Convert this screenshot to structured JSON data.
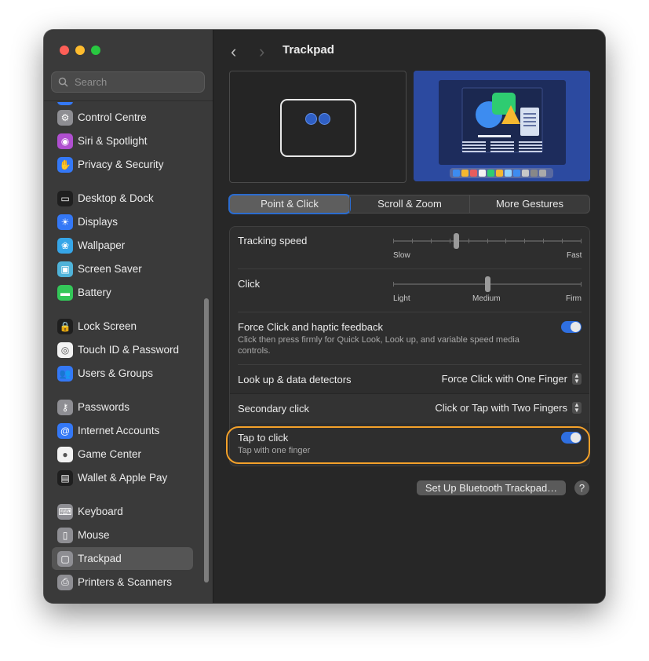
{
  "window": {
    "title": "Trackpad"
  },
  "search": {
    "placeholder": "Search"
  },
  "sidebar": {
    "items": [
      {
        "label": "Control Centre",
        "icon": "control-centre-icon",
        "color": "#8e8e93",
        "glyph": "⚙"
      },
      {
        "label": "Siri & Spotlight",
        "icon": "siri-icon",
        "color": "#b04fd0",
        "glyph": "◉"
      },
      {
        "label": "Privacy & Security",
        "icon": "hand-icon",
        "color": "#3478f6",
        "glyph": "✋"
      },
      {
        "label": "Desktop & Dock",
        "icon": "dock-icon",
        "color": "#1f1f1f",
        "glyph": "▭"
      },
      {
        "label": "Displays",
        "icon": "displays-icon",
        "color": "#3478f6",
        "glyph": "☀"
      },
      {
        "label": "Wallpaper",
        "icon": "wallpaper-icon",
        "color": "#36a6e8",
        "glyph": "❀"
      },
      {
        "label": "Screen Saver",
        "icon": "screen-saver-icon",
        "color": "#4fb3d9",
        "glyph": "▣"
      },
      {
        "label": "Battery",
        "icon": "battery-icon",
        "color": "#34c759",
        "glyph": "▬"
      },
      {
        "label": "Lock Screen",
        "icon": "lock-icon",
        "color": "#1f1f1f",
        "glyph": "🔒"
      },
      {
        "label": "Touch ID & Password",
        "icon": "fingerprint-icon",
        "color": "#f2f2f2",
        "glyph": "◎"
      },
      {
        "label": "Users & Groups",
        "icon": "users-icon",
        "color": "#3478f6",
        "glyph": "👥"
      },
      {
        "label": "Passwords",
        "icon": "key-icon",
        "color": "#8e8e93",
        "glyph": "⚷"
      },
      {
        "label": "Internet Accounts",
        "icon": "at-icon",
        "color": "#3478f6",
        "glyph": "@"
      },
      {
        "label": "Game Center",
        "icon": "game-center-icon",
        "color": "#f2f2f2",
        "glyph": "●"
      },
      {
        "label": "Wallet & Apple Pay",
        "icon": "wallet-icon",
        "color": "#1f1f1f",
        "glyph": "▤"
      },
      {
        "label": "Keyboard",
        "icon": "keyboard-icon",
        "color": "#8e8e93",
        "glyph": "⌨"
      },
      {
        "label": "Mouse",
        "icon": "mouse-icon",
        "color": "#8e8e93",
        "glyph": "▯"
      },
      {
        "label": "Trackpad",
        "icon": "trackpad-icon",
        "color": "#8e8e93",
        "glyph": "▢"
      },
      {
        "label": "Printers & Scanners",
        "icon": "printer-icon",
        "color": "#8e8e93",
        "glyph": "⎙"
      }
    ]
  },
  "tabs": [
    {
      "label": "Point & Click"
    },
    {
      "label": "Scroll & Zoom"
    },
    {
      "label": "More Gestures"
    }
  ],
  "settings": {
    "tracking_speed": {
      "label": "Tracking speed",
      "min_label": "Slow",
      "max_label": "Fast",
      "value_fraction": 0.33
    },
    "click": {
      "label": "Click",
      "left_label": "Light",
      "mid_label": "Medium",
      "right_label": "Firm",
      "value_fraction": 0.5
    },
    "force_click": {
      "label": "Force Click and haptic feedback",
      "description": "Click then press firmly for Quick Look, Look up, and variable speed media controls.",
      "enabled": true
    },
    "look_up": {
      "label": "Look up & data detectors",
      "value": "Force Click with One Finger"
    },
    "secondary_click": {
      "label": "Secondary click",
      "value": "Click or Tap with Two Fingers"
    },
    "tap_to_click": {
      "label": "Tap to click",
      "description": "Tap with one finger",
      "enabled": true
    }
  },
  "buttons": {
    "bluetooth": "Set Up Bluetooth Trackpad…",
    "help": "?"
  },
  "colors": {
    "accent": "#2f6fe0",
    "highlight": "#f4a12a"
  }
}
